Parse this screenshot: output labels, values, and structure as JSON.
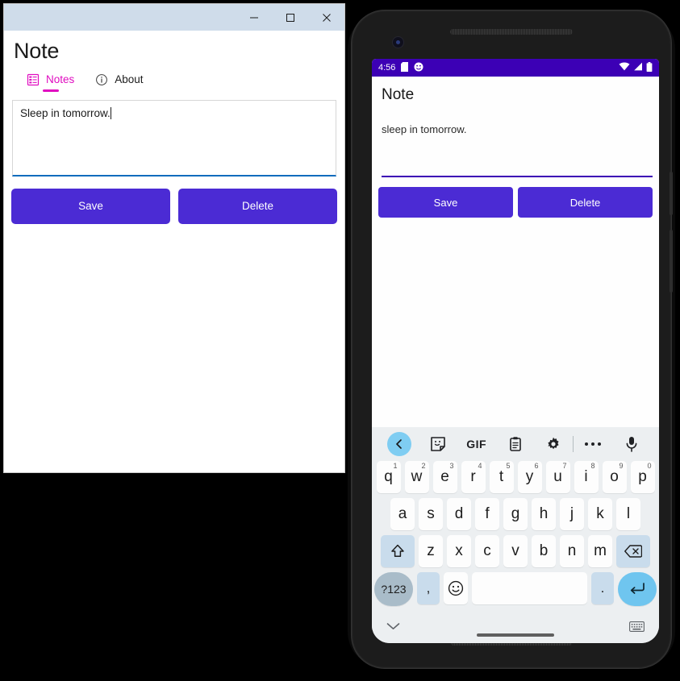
{
  "desktop": {
    "window_controls": {
      "minimize": "minimize-icon",
      "maximize": "maximize-icon",
      "close": "close-icon"
    },
    "app_title": "Note",
    "tabs": [
      {
        "label": "Notes",
        "icon": "list-icon",
        "active": true
      },
      {
        "label": "About",
        "icon": "info-circle-icon",
        "active": false
      }
    ],
    "note_text": "Sleep in tomorrow.",
    "buttons": [
      {
        "label": "Save"
      },
      {
        "label": "Delete"
      }
    ],
    "colors": {
      "titlebar": "#cfdcea",
      "accent_tab": "#e00cc0",
      "field_underline": "#0f6cbd",
      "button": "#4b2bd4"
    }
  },
  "phone": {
    "statusbar": {
      "time": "4:56",
      "left_icons": [
        "sd-card-icon",
        "face-icon"
      ],
      "right_icons": [
        "wifi-icon",
        "signal-icon",
        "battery-icon"
      ],
      "background": "#3c00b5"
    },
    "app_title": "Note",
    "note_text": "sleep in tomorrow.",
    "buttons": [
      {
        "label": "Save"
      },
      {
        "label": "Delete"
      }
    ],
    "keyboard": {
      "toolbar": [
        "back-chevron-icon",
        "sticker-icon",
        "gif-icon",
        "clipboard-icon",
        "gear-icon",
        "divider",
        "more-icon",
        "microphone-icon"
      ],
      "gif_label": "GIF",
      "row1": [
        {
          "key": "q",
          "sup": "1"
        },
        {
          "key": "w",
          "sup": "2"
        },
        {
          "key": "e",
          "sup": "3"
        },
        {
          "key": "r",
          "sup": "4"
        },
        {
          "key": "t",
          "sup": "5"
        },
        {
          "key": "y",
          "sup": "6"
        },
        {
          "key": "u",
          "sup": "7"
        },
        {
          "key": "i",
          "sup": "8"
        },
        {
          "key": "o",
          "sup": "9"
        },
        {
          "key": "p",
          "sup": "0"
        }
      ],
      "row2": [
        "a",
        "s",
        "d",
        "f",
        "g",
        "h",
        "j",
        "k",
        "l"
      ],
      "row3_letters": [
        "z",
        "x",
        "c",
        "v",
        "b",
        "n",
        "m"
      ],
      "shift_key": "shift-icon",
      "backspace_key": "backspace-icon",
      "row4": {
        "numeric_label": "?123",
        "comma": ",",
        "emoji": "emoji-icon",
        "space": "",
        "period": ".",
        "enter": "enter-icon"
      }
    },
    "navbar": {
      "back": "chevron-down-icon",
      "home": "home-pill",
      "keyboard_switch": "keyboard-icon"
    },
    "colors": {
      "keyboard_bg": "#eceff1",
      "key_bg": "#fdfdfd",
      "func_key_bg": "#c9dcec",
      "enter_key_bg": "#6fc5ef",
      "button": "#4b2bd4"
    }
  }
}
